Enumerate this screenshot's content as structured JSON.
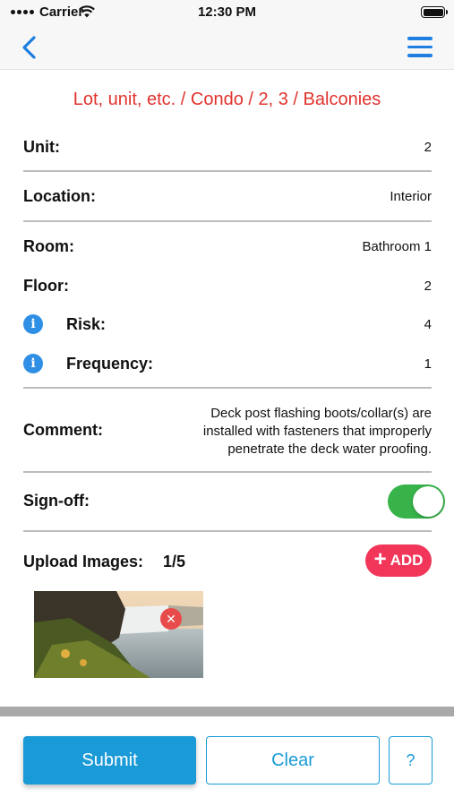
{
  "status_bar": {
    "carrier": "Carrier",
    "time": "12:30 PM",
    "battery_level": 1.0
  },
  "nav": {
    "back_icon": "chevron-left-icon",
    "menu_icon": "hamburger-menu-icon",
    "accent_color": "#1f7ee0"
  },
  "breadcrumb": "Lot, unit, etc. / Condo / 2, 3 / Balconies",
  "fields": {
    "unit": {
      "label": "Unit:",
      "value": "2"
    },
    "location": {
      "label": "Location:",
      "value": "Interior"
    },
    "room": {
      "label": "Room:",
      "value": "Bathroom 1"
    },
    "floor": {
      "label": "Floor:",
      "value": "2"
    },
    "risk": {
      "label": "Risk:",
      "value": "4",
      "icon": "info-icon"
    },
    "frequency": {
      "label": "Frequency:",
      "value": "1",
      "icon": "info-icon"
    },
    "comment": {
      "label": "Comment:",
      "value": "Deck post flashing boots/collar(s) are installed with fasteners that improperly penetrate the deck water proofing."
    },
    "signoff": {
      "label": "Sign-off:",
      "checked": true,
      "color": "#37b34a"
    }
  },
  "upload": {
    "label": "Upload Images:",
    "count": "1/5",
    "add_label": "ADD",
    "add_color": "#f1365a",
    "image_icon": "waterfall-photo",
    "remove_icon": "close-icon"
  },
  "buttons": {
    "submit": "Submit",
    "clear": "Clear",
    "help": "?",
    "primary_color": "#1a9ad6"
  },
  "colors": {
    "breadcrumb": "#e0322d",
    "info_icon": "#2f8fe4"
  }
}
